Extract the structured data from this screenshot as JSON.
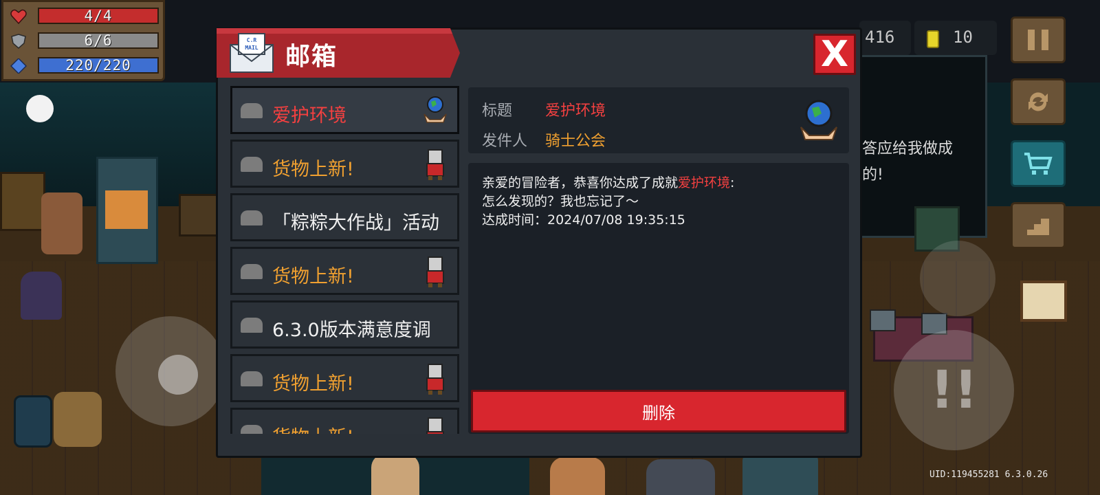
{
  "hud": {
    "hp": "4/4",
    "armor": "6/6",
    "energy": "220/220",
    "gems": "416",
    "coins": "10",
    "uid": "UID:119455281 6.3.0.26"
  },
  "background": {
    "npc_text_1": "答应给我做成",
    "npc_text_2": "的!"
  },
  "mailbox": {
    "title": "邮箱",
    "logo_text": "C.R MAIL",
    "close_label": "X",
    "items": [
      {
        "label": "爱护环境",
        "color": "red",
        "icon": "globe-hands-icon"
      },
      {
        "label": "货物上新!",
        "color": "orange",
        "icon": "merchant-avatar-icon"
      },
      {
        "label": "「粽粽大作战」活动",
        "color": "white",
        "icon": ""
      },
      {
        "label": "货物上新!",
        "color": "orange",
        "icon": "merchant-avatar-icon"
      },
      {
        "label": "6.3.0版本满意度调",
        "color": "white",
        "icon": ""
      },
      {
        "label": "货物上新!",
        "color": "orange",
        "icon": "merchant-avatar-icon"
      },
      {
        "label": "货物上新!",
        "color": "orange",
        "icon": "merchant-avatar-icon"
      }
    ],
    "detail": {
      "subject_key": "标题",
      "subject_value": "爱护环境",
      "sender_key": "发件人",
      "sender_value": "骑士公会",
      "body_line1_prefix": "亲爱的冒险者，恭喜你达成了成就",
      "body_line1_highlight": "爱护环境",
      "body_line1_suffix": ":",
      "body_line2": "怎么发现的？我也忘记了～",
      "body_line3": "达成时间：2024/07/08 19:35:15"
    },
    "delete_label": "删除"
  },
  "colors": {
    "accent_red": "#d8262e",
    "highlight_red": "#f44040",
    "orange": "#f0a030",
    "panel": "#2a3037"
  }
}
